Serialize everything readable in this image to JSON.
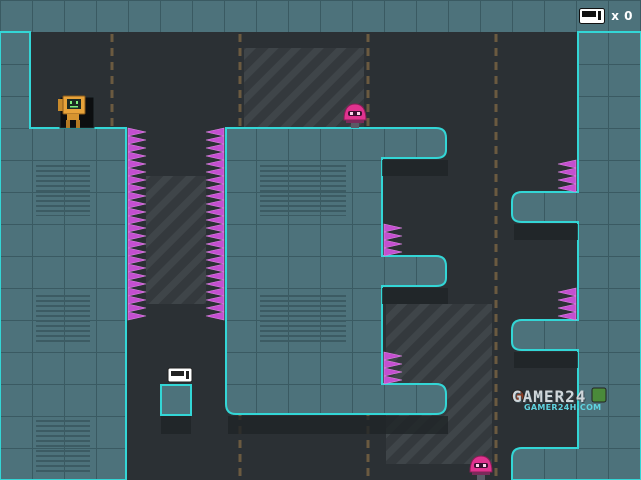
{
  "game": {
    "hud": {
      "counter_icon": "floppy-disk-icon",
      "counter_text": "x 0"
    },
    "watermark": {
      "name": "GAMER24",
      "domain": "GAMER24H.COM"
    },
    "entities": {
      "player": "robot-player",
      "enemies": [
        "pink-dome-robot-enemy",
        "pink-dome-robot-enemy"
      ],
      "collectible": "floppy-disk-pickup"
    },
    "colors": {
      "background": "#2b3034",
      "wall_fill": "#4a6f78",
      "wall_edge": "#33d6d6",
      "spike": "#c44fd0",
      "enemy": "#e0338f",
      "player": "#e8a33a"
    }
  }
}
